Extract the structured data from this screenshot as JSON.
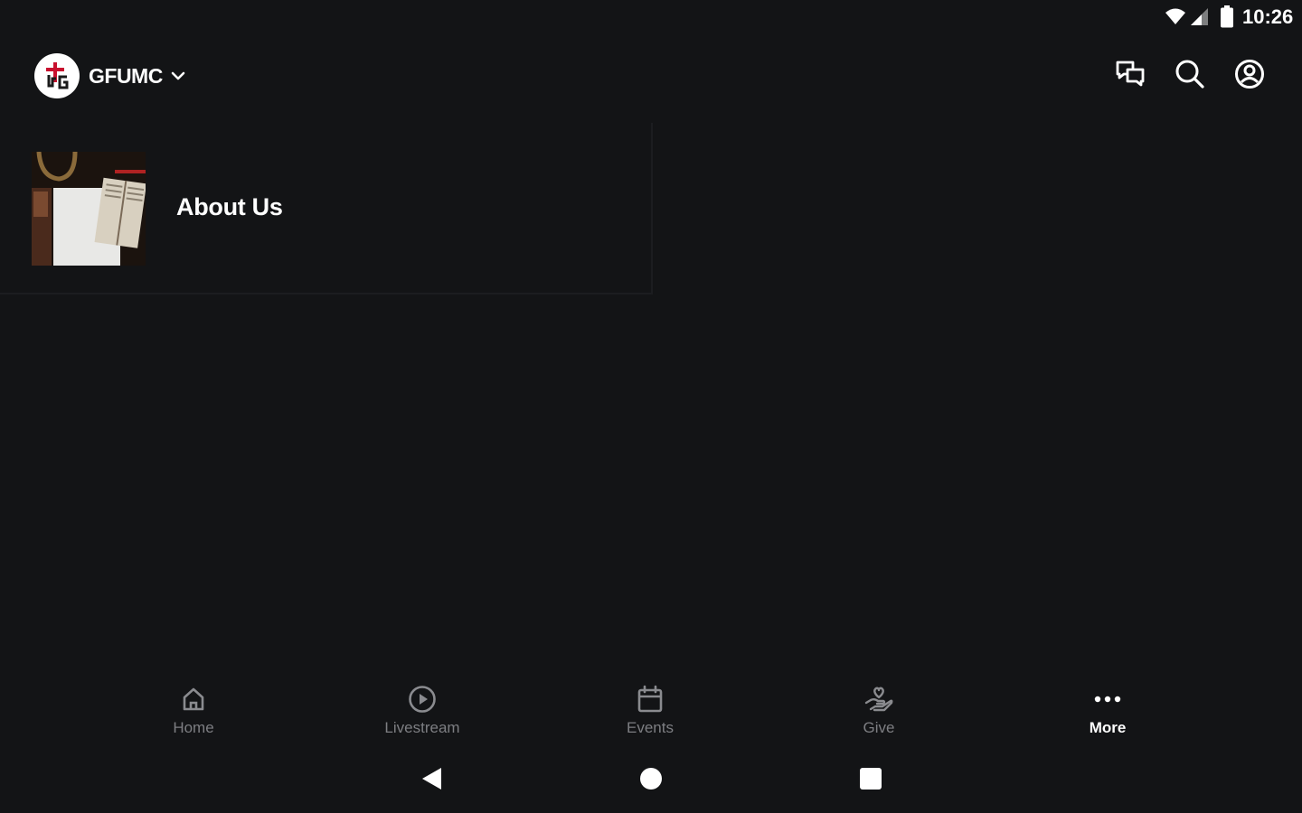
{
  "status_bar": {
    "time": "10:26",
    "icons": [
      "wifi-icon",
      "cell-signal-icon",
      "battery-icon"
    ]
  },
  "app_bar": {
    "org_name": "GFUMC",
    "actions": [
      "chat-icon",
      "search-icon",
      "account-icon"
    ]
  },
  "content": {
    "items": [
      {
        "title": "About Us",
        "thumbnail": "bible-on-table-image"
      }
    ]
  },
  "bottom_nav": {
    "items": [
      {
        "label": "Home",
        "icon": "home-icon"
      },
      {
        "label": "Livestream",
        "icon": "play-circle-icon"
      },
      {
        "label": "Events",
        "icon": "calendar-icon"
      },
      {
        "label": "Give",
        "icon": "give-hand-heart-icon"
      },
      {
        "label": "More",
        "icon": "more-dots-icon",
        "active": true
      }
    ]
  },
  "system_nav": {
    "buttons": [
      "back-icon",
      "home-circle-icon",
      "recents-icon"
    ]
  },
  "colors": {
    "background": "#131416",
    "text_primary": "#ffffff",
    "text_inactive": "#7d7e82",
    "logo_red": "#c8102e"
  }
}
